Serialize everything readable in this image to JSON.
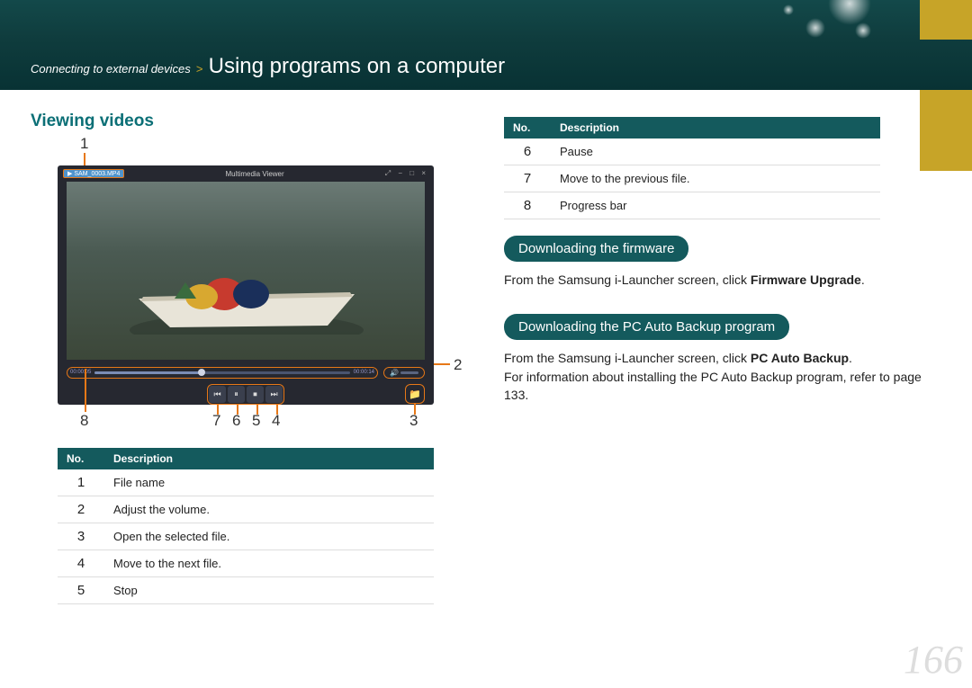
{
  "header": {
    "breadcrumb_parent": "Connecting to external devices",
    "breadcrumb_sep": ">",
    "breadcrumb_current": "Using programs on a computer"
  },
  "left": {
    "section_title": "Viewing videos",
    "viewer": {
      "app_title": "Multimedia Viewer",
      "file_name": "SAM_0003.MP4",
      "time_current": "00:00:05",
      "time_total": "00:00:14"
    },
    "callouts": {
      "c1": "1",
      "c2": "2",
      "c3": "3",
      "c4": "4",
      "c5": "5",
      "c6": "6",
      "c7": "7",
      "c8": "8"
    },
    "table": {
      "headers": {
        "no": "No.",
        "desc": "Description"
      },
      "rows": [
        {
          "no": "1",
          "desc": "File name"
        },
        {
          "no": "2",
          "desc": "Adjust the volume."
        },
        {
          "no": "3",
          "desc": "Open the selected file."
        },
        {
          "no": "4",
          "desc": "Move to the next file."
        },
        {
          "no": "5",
          "desc": "Stop"
        }
      ]
    }
  },
  "right": {
    "table": {
      "headers": {
        "no": "No.",
        "desc": "Description"
      },
      "rows": [
        {
          "no": "6",
          "desc": "Pause"
        },
        {
          "no": "7",
          "desc": "Move to the previous file."
        },
        {
          "no": "8",
          "desc": "Progress bar"
        }
      ]
    },
    "pill1": "Downloading the firmware",
    "text1_a": "From the Samsung i-Launcher screen, click ",
    "text1_b": "Firmware Upgrade",
    "text1_c": ".",
    "pill2": "Downloading the PC Auto Backup program",
    "text2_a": "From the Samsung i-Launcher screen, click ",
    "text2_b": "PC Auto Backup",
    "text2_c": ". ",
    "text2_d": "For information about installing the PC Auto Backup program, refer to page 133."
  },
  "page_number": "166"
}
